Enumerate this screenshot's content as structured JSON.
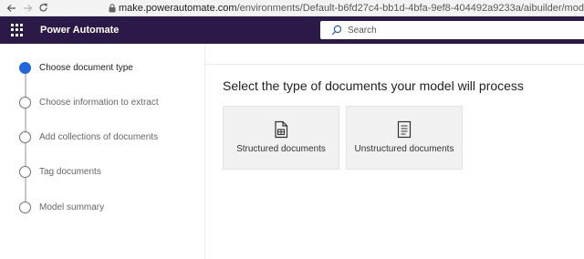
{
  "browser": {
    "url_host": "make.powerautomate.com",
    "url_path": "/environments/Default-b6fd27c4-bb1d-4bfa-9ef8-404492a9233a/aibuilder/mod"
  },
  "header": {
    "app_title": "Power Automate",
    "search_placeholder": "Search",
    "background": "#2b1a47"
  },
  "stepper": {
    "steps": [
      {
        "label": "Choose document type",
        "active": true
      },
      {
        "label": "Choose information to extract",
        "active": false
      },
      {
        "label": "Add collections of documents",
        "active": false
      },
      {
        "label": "Tag documents",
        "active": false
      },
      {
        "label": "Model summary",
        "active": false
      }
    ],
    "active_color": "#2266dd"
  },
  "main": {
    "heading": "Select the type of documents your model will process",
    "cards": [
      {
        "label": "Structured documents",
        "icon": "structured-document-icon"
      },
      {
        "label": "Unstructured documents",
        "icon": "unstructured-document-icon"
      }
    ]
  }
}
